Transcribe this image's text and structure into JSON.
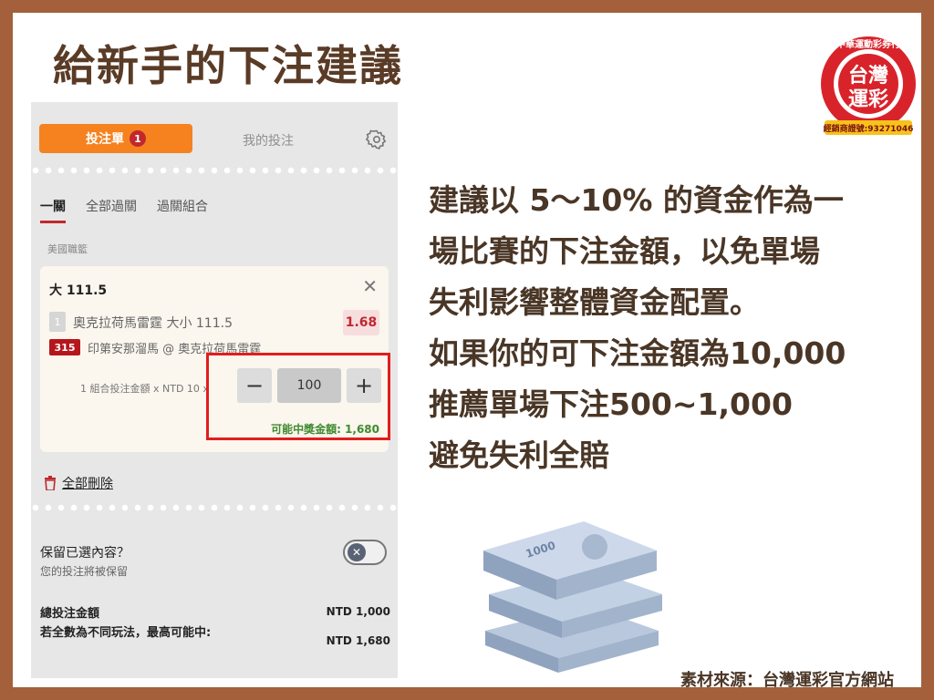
{
  "slide": {
    "title": "給新手的下注建議",
    "source": "素材來源：台灣運彩官方網站"
  },
  "logo": {
    "arc_text": "中華運動彩券行",
    "line1": "台灣",
    "line2": "運彩",
    "license": "經銷商證號:93271046",
    "color": "#d9232b"
  },
  "app": {
    "tabs": {
      "betslip": "投注單",
      "betslip_badge": "1",
      "my_bets": "我的投注"
    },
    "subtabs": [
      "一關",
      "全部過關",
      "過關組合"
    ],
    "league": "美國職籃",
    "bet": {
      "title": "大 111.5",
      "selection_num": "1",
      "selection": "奧克拉荷馬雷霆 大小 111.5",
      "odds": "1.68",
      "game_code": "315",
      "game": "印第安那溜馬 @ 奧克拉荷馬雷霆",
      "formula": "1 組合投注金額 x NTD 10 x",
      "stake": "100",
      "potential_win": "可能中獎金額: 1,680"
    },
    "delete_all": "全部刪除",
    "keep": {
      "title": "保留已選內容？",
      "subtitle": "您的投注將被保留"
    },
    "totals": {
      "total_label": "總投注金額",
      "total_value": "NTD 1,000",
      "max_label": "若全數為不同玩法，最高可能中:",
      "max_value": "NTD 1,680"
    },
    "colors": {
      "accent": "#f5821f",
      "highlight": "#e21d1d",
      "win": "#3f8a2e"
    }
  },
  "advice": [
    "建議以 5～10% 的資金作為一",
    "場比賽的下注金額，以免單場",
    "失利影響整體資金配置。",
    "如果你的可下注金額為10,000",
    "推薦單場下注500~1,000",
    "避免失利全賠"
  ]
}
